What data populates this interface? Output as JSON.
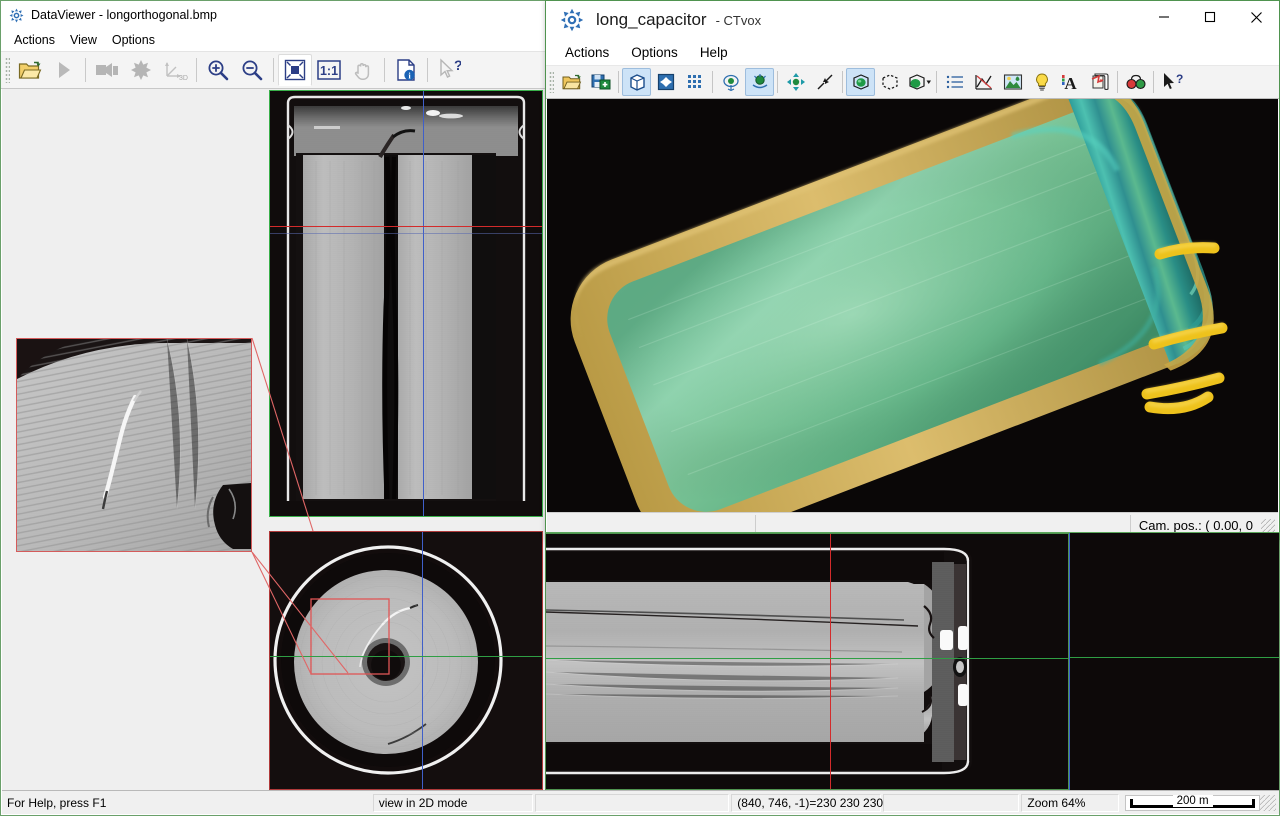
{
  "dataviewer": {
    "window_title": "DataViewer - longorthogonal.bmp",
    "app_icon": "dataviewer-logo-icon",
    "menu": [
      {
        "label": "Actions",
        "name": "actions"
      },
      {
        "label": "View",
        "name": "view"
      },
      {
        "label": "Options",
        "name": "options"
      }
    ],
    "toolbar": [
      {
        "name": "open-file-icon",
        "tip": "Open",
        "state": "enabled"
      },
      {
        "name": "play-icon",
        "tip": "Play",
        "state": "disabled"
      },
      {
        "name": "movie-icon",
        "tip": "Create movie",
        "state": "disabled"
      },
      {
        "name": "star-icon",
        "tip": "Effects",
        "state": "disabled"
      },
      {
        "name": "axes-3d-icon",
        "tip": "3D axes",
        "state": "disabled"
      },
      {
        "name": "zoom-in-icon",
        "tip": "Zoom in",
        "state": "enabled"
      },
      {
        "name": "zoom-out-icon",
        "tip": "Zoom out",
        "state": "enabled"
      },
      {
        "name": "fit-to-window-icon",
        "tip": "Fit to window",
        "state": "pressed"
      },
      {
        "name": "zoom-one-to-one-icon",
        "tip": "1:1",
        "state": "enabled"
      },
      {
        "name": "pan-hand-icon",
        "tip": "Pan",
        "state": "disabled"
      },
      {
        "name": "dataset-info-icon",
        "tip": "Dataset information",
        "state": "enabled"
      },
      {
        "name": "context-help-icon",
        "tip": "Context help",
        "state": "disabled"
      }
    ],
    "toolbar_labels": {
      "one_to_one": "1:1",
      "axes_3d": "3D"
    },
    "statusbar": {
      "help_hint": "For Help, press F1",
      "view_mode": "view in 2D mode",
      "empty_cell": "",
      "voxel_readout": "(840, 746, -1)=230 230 230",
      "zoom": "Zoom 64%",
      "scale_label": "200 m"
    }
  },
  "ctvox": {
    "window_title_name": "long_capacitor",
    "window_title_app": "- CTvox",
    "app_icon": "ctvox-logo-icon",
    "window_controls": [
      {
        "name": "minimize-button",
        "glyph": "–"
      },
      {
        "name": "maximize-button",
        "glyph": "□"
      },
      {
        "name": "close-button",
        "glyph": "✕"
      }
    ],
    "menu": [
      {
        "label": "Actions",
        "name": "actions"
      },
      {
        "label": "Options",
        "name": "options"
      },
      {
        "label": "Help",
        "name": "help"
      }
    ],
    "toolbar": [
      {
        "name": "open-dataset-icon",
        "state": "enabled"
      },
      {
        "name": "save-dataset-icon",
        "state": "enabled"
      },
      {
        "name": "render-volume-icon",
        "state": "active"
      },
      {
        "name": "render-slice-icon",
        "state": "enabled"
      },
      {
        "name": "render-grid-icon",
        "state": "enabled"
      },
      {
        "name": "view-eye-icon",
        "state": "enabled"
      },
      {
        "name": "view-eye-light-icon",
        "state": "active"
      },
      {
        "name": "move-object-icon",
        "state": "enabled"
      },
      {
        "name": "shrink-object-icon",
        "state": "enabled"
      },
      {
        "name": "bounding-box-solid-icon",
        "state": "active"
      },
      {
        "name": "bounding-box-dashed-icon",
        "state": "enabled"
      },
      {
        "name": "clip-object-dropdown-icon",
        "state": "enabled"
      },
      {
        "name": "list-icon",
        "state": "enabled"
      },
      {
        "name": "transfer-function-icon",
        "state": "enabled"
      },
      {
        "name": "image-gallery-icon",
        "state": "enabled"
      },
      {
        "name": "lightbulb-icon",
        "state": "enabled"
      },
      {
        "name": "text-color-icon",
        "state": "enabled"
      },
      {
        "name": "animation-script-icon",
        "state": "enabled"
      },
      {
        "name": "stereo-glasses-icon",
        "state": "enabled"
      },
      {
        "name": "context-help-icon",
        "state": "enabled"
      }
    ],
    "statusbar": {
      "left_cell": "",
      "camera_position": "Cam. pos.: ( 0.00, 0"
    },
    "render": {
      "background_color": "#0b0808",
      "body_color": "#6fbf8f",
      "body_color_center": "#96d6b0",
      "rim_color": "#c9a341",
      "edge_cyan": "#2fa79c",
      "lead_color": "#f0c419",
      "leads_count": 4
    }
  },
  "panels": {
    "slice_top": {
      "name": "coronal-slice-panel",
      "border_color": "#39b04a",
      "crosshair_vertical_color": "#3a5fd0",
      "crosshair_horizontal_color": "#d02020"
    },
    "slice_axial": {
      "name": "axial-slice-panel",
      "border_color": "#b03a3a",
      "crosshair_vertical_color": "#3a5fd0",
      "crosshair_horizontal_color": "#2f9e44"
    },
    "slice_sagittal": {
      "name": "sagittal-slice-panel",
      "border_color": "#39b04a",
      "crosshair_vertical_color": "#d02020",
      "crosshair_horizontal_color": "#2f9e44"
    },
    "inset": {
      "name": "magnified-detail-panel",
      "border_color": "#d45b5b",
      "callout_color": "#e06666"
    }
  }
}
